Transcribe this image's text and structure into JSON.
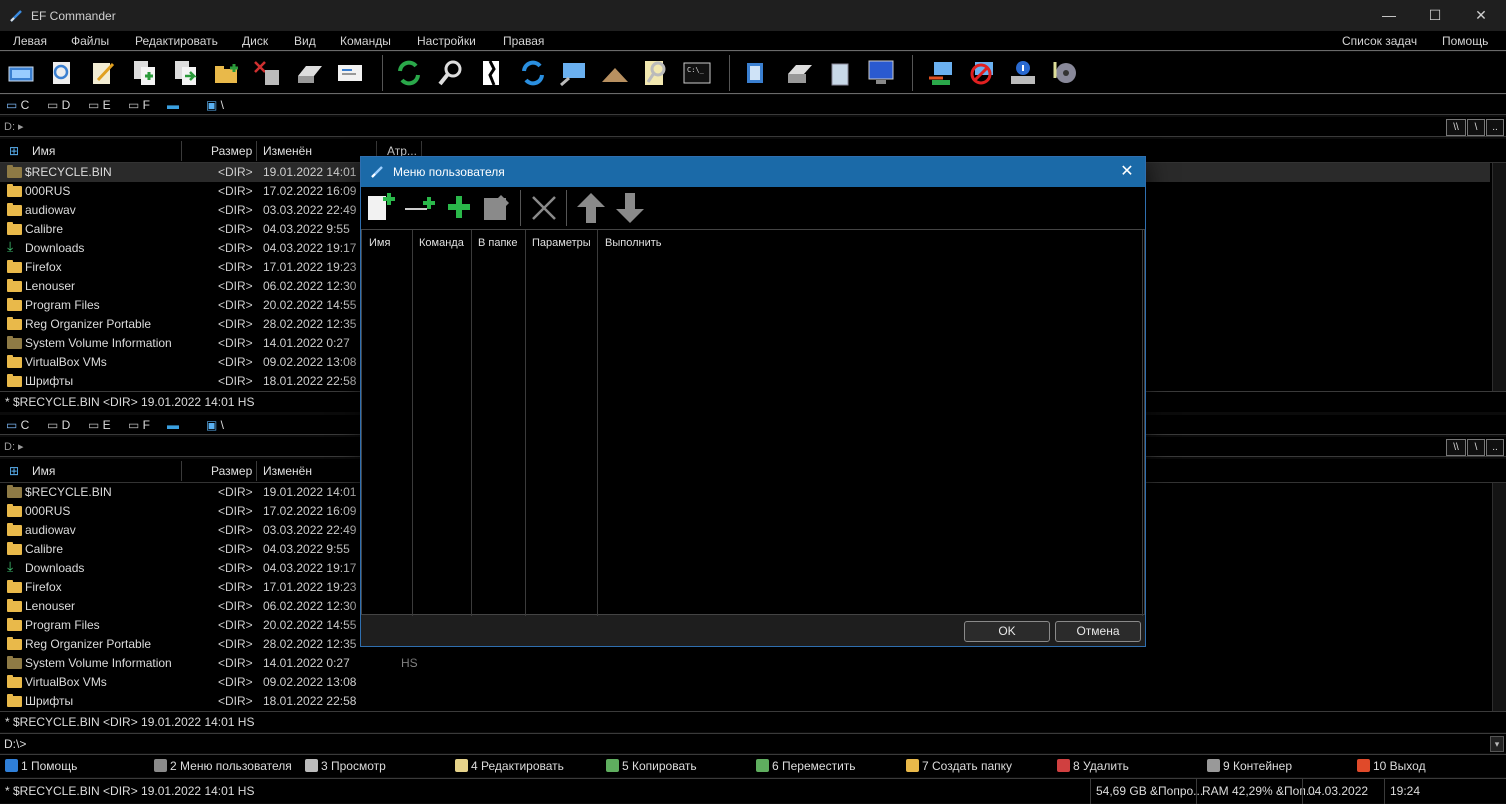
{
  "app": {
    "title": "EF Commander",
    "controls": {
      "minimize": "—",
      "maximize": "☐",
      "close": "✕"
    }
  },
  "menu": {
    "items": [
      "Левая",
      "Файлы",
      "Редактировать",
      "Диск",
      "Вид",
      "Команды",
      "Настройки",
      "Правая"
    ],
    "right_items": [
      "Список задач",
      "Помощь"
    ]
  },
  "toolbar": {
    "icons": [
      "open-panel-icon",
      "view-icon",
      "edit-icon",
      "copy-icon",
      "move-icon",
      "new-folder-icon",
      "delete-icon",
      "print-icon",
      "send-mail-icon",
      "refresh-icon",
      "search-icon",
      "split-icon",
      "sync-icon",
      "network-icon",
      "pyramid-icon",
      "find-files-icon",
      "console-icon",
      "user-menu-icon",
      "printer-setup-icon",
      "recycle-bin-icon",
      "monitor-icon",
      "connect-network-icon",
      "disconnect-network-icon",
      "drive-info-icon",
      "audio-icon"
    ]
  },
  "drives": {
    "items": [
      "C",
      "D",
      "E",
      "F",
      "",
      "\\"
    ]
  },
  "panels": {
    "top": {
      "path": "D: ▸",
      "path_buttons": [
        "\\\\",
        "\\",
        ".."
      ],
      "columns": {
        "name": "Имя",
        "size": "Размер",
        "modified": "Изменён",
        "attr": "Атр..."
      },
      "status": "* $RECYCLE.BIN    <DIR>  19.01.2022  14:01   HS"
    },
    "bottom": {
      "path": "D: ▸",
      "path_buttons": [
        "\\\\",
        "\\",
        ".."
      ],
      "columns": {
        "name": "Имя",
        "size": "Размер",
        "modified": "Изменён"
      },
      "status": "* $RECYCLE.BIN    <DIR>  19.01.2022  14:01   HS"
    },
    "files": [
      {
        "name": "$RECYCLE.BIN",
        "size": "<DIR>",
        "modified": "19.01.2022  14:01",
        "attr": "HS",
        "type": "system"
      },
      {
        "name": "000RUS",
        "size": "<DIR>",
        "modified": "17.02.2022  16:09",
        "attr": "",
        "type": "folder"
      },
      {
        "name": "audiowav",
        "size": "<DIR>",
        "modified": "03.03.2022  22:49",
        "attr": "",
        "type": "folder"
      },
      {
        "name": "Calibre",
        "size": "<DIR>",
        "modified": "04.03.2022   9:55",
        "attr": "",
        "type": "folder"
      },
      {
        "name": "Downloads",
        "size": "<DIR>",
        "modified": "04.03.2022  19:17",
        "attr": "",
        "type": "download"
      },
      {
        "name": "Firefox",
        "size": "<DIR>",
        "modified": "17.01.2022  19:23",
        "attr": "",
        "type": "folder"
      },
      {
        "name": "Lenouser",
        "size": "<DIR>",
        "modified": "06.02.2022  12:30",
        "attr": "",
        "type": "folder"
      },
      {
        "name": "Program Files",
        "size": "<DIR>",
        "modified": "20.02.2022  14:55",
        "attr": "",
        "type": "folder"
      },
      {
        "name": "Reg Organizer Portable",
        "size": "<DIR>",
        "modified": "28.02.2022  12:35",
        "attr": "",
        "type": "folder"
      },
      {
        "name": "System Volume Information",
        "size": "<DIR>",
        "modified": "14.01.2022   0:27",
        "attr": "HS",
        "type": "system"
      },
      {
        "name": "VirtualBox VMs",
        "size": "<DIR>",
        "modified": "09.02.2022  13:08",
        "attr": "",
        "type": "folder"
      },
      {
        "name": "Шрифты",
        "size": "<DIR>",
        "modified": "18.01.2022  22:58",
        "attr": "",
        "type": "folder"
      }
    ]
  },
  "cmdline": {
    "prompt": "D:\\>"
  },
  "fkeys": [
    {
      "label": "1 Помощь",
      "color": "#2f7fd8"
    },
    {
      "label": "2 Меню пользователя",
      "color": "#8a8a8a"
    },
    {
      "label": "3 Просмотр",
      "color": "#bbbbbb"
    },
    {
      "label": "4 Редактировать",
      "color": "#e6d38a"
    },
    {
      "label": "5 Копировать",
      "color": "#5fae5f"
    },
    {
      "label": "6 Переместить",
      "color": "#5fae5f"
    },
    {
      "label": "7 Создать папку",
      "color": "#e9b94a"
    },
    {
      "label": "8 Удалить",
      "color": "#d04040"
    },
    {
      "label": "9 Контейнер",
      "color": "#999999"
    },
    {
      "label": "10 Выход",
      "color": "#e04a2a"
    }
  ],
  "statusbar": {
    "selection": "* $RECYCLE.BIN    <DIR>  19.01.2022  14:01   HS",
    "disk": "54,69 GB &Попро...",
    "ram": "RAM 42,29% &Поп...",
    "date": "04.03.2022",
    "time": "19:24"
  },
  "dialog": {
    "title": "Меню пользователя",
    "columns": [
      "Имя",
      "Команда",
      "В папке",
      "Параметры",
      "Выполнить"
    ],
    "ok": "OK",
    "cancel": "Отмена",
    "tools": [
      "new-item-icon",
      "add-separator-icon",
      "add-submenu-icon",
      "edit-item-icon",
      "delete-item-icon",
      "move-up-icon",
      "move-down-icon"
    ]
  },
  "colors": {
    "dialog_title": "#1b6aa8",
    "folder": "#e9b94a",
    "accent_blue": "#2f7fd8"
  }
}
